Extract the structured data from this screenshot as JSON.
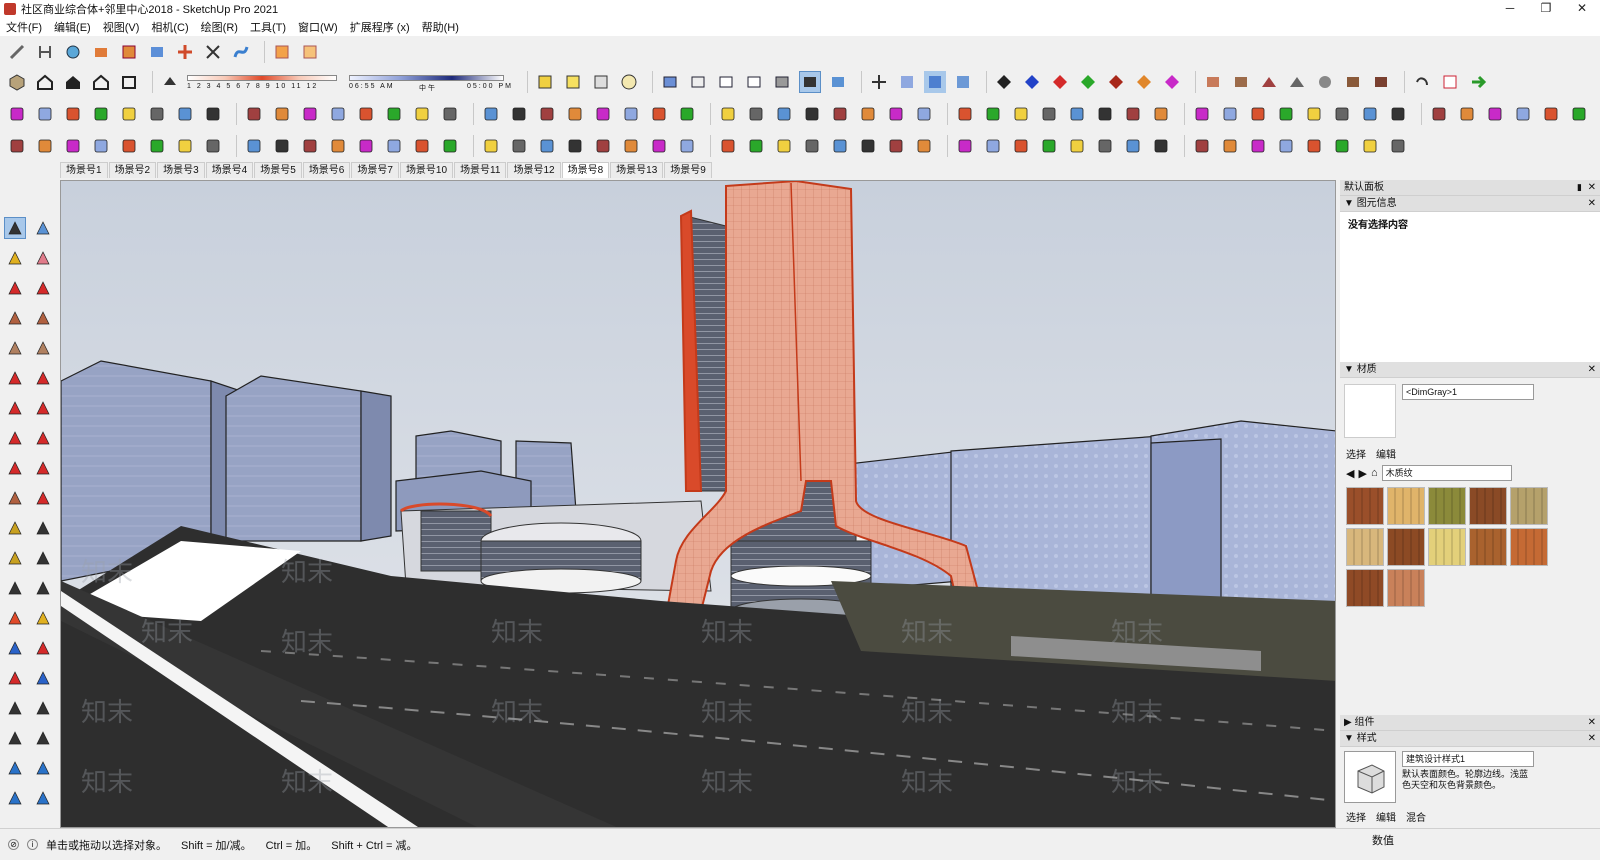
{
  "window": {
    "title": "社区商业综合体+邻里中心2018 - SketchUp Pro 2021",
    "controls": [
      "─",
      "❐",
      "✕"
    ]
  },
  "menu": [
    "文件(F)",
    "编辑(E)",
    "视图(V)",
    "相机(C)",
    "绘图(R)",
    "工具(T)",
    "窗口(W)",
    "扩展程序 (x)",
    "帮助(H)"
  ],
  "shadow": {
    "month_ticks": "1 2 3 4 5 6 7 8 9 10 11 12",
    "time_start": "06:55 AM",
    "time_mid": "中午",
    "time_end": "05:00 PM"
  },
  "scene_tabs": [
    "场景号1",
    "场景号2",
    "场景号3",
    "场景号4",
    "场景号5",
    "场景号6",
    "场景号7",
    "场景号10",
    "场景号11",
    "场景号12",
    "场景号8",
    "场景号13",
    "场景号9"
  ],
  "active_scene_index": 10,
  "tray": {
    "title": "默认面板",
    "entity_info": {
      "header": "图元信息",
      "body": "没有选择内容"
    },
    "materials": {
      "header": "材质",
      "current_name": "<DimGray>1",
      "tab_select": "选择",
      "tab_edit": "编辑",
      "library": "木质纹",
      "swatch_colors": [
        "#9a4f2a",
        "#e0b46a",
        "#8b8a3a",
        "#8a4a26",
        "#b5a16b",
        "#d8b77c",
        "#8c4a24",
        "#e3d07a",
        "#a9622e",
        "#c56a34",
        "#8f4a26",
        "#c9815a"
      ]
    },
    "components": {
      "header": "组件"
    },
    "styles": {
      "header": "样式",
      "name": "建筑设计样式1",
      "description": "默认表面颜色。轮廓边线。浅蓝色天空和灰色背景颜色。",
      "tab_select": "选择",
      "tab_edit": "编辑",
      "tab_mix": "混合"
    }
  },
  "status": {
    "message": "单击或拖动以选择对象。",
    "hint_shift": "Shift = 加/减。",
    "hint_ctrl": "Ctrl = 加。",
    "hint_shift_ctrl": "Shift + Ctrl = 减。",
    "vcb_label": "数值"
  },
  "viewport": {
    "sky_top": "#c8d0dc",
    "sky_bottom": "#e6e8ec",
    "road_color": "#2e2e2e",
    "tower_color": "#e8a690",
    "accent_red": "#d9532f",
    "glass_color": "#9aa6c8",
    "watermark": "知末"
  }
}
